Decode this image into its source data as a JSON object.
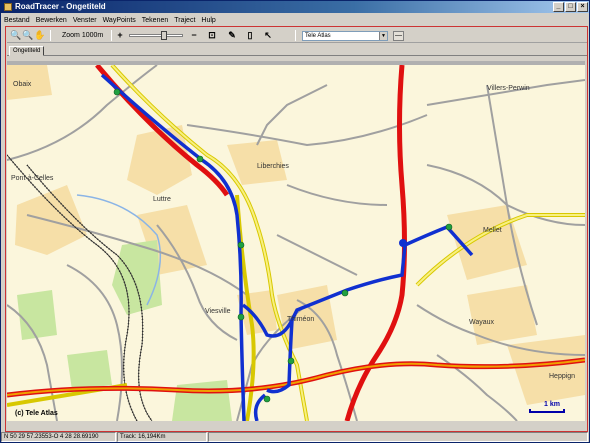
{
  "window": {
    "title": "RoadTracer - Ongetiteld",
    "controls": [
      "_",
      "□",
      "×"
    ]
  },
  "menu": [
    "Bestand",
    "Bewerken",
    "Venster",
    "WayPoints",
    "Tekenen",
    "Traject",
    "Hulp"
  ],
  "toolbar": {
    "zoom_label": "Zoom 1000m",
    "map_source": "Tele Atlas",
    "buttons": {
      "zoom_in_glass": "🔍",
      "zoom_out_glass": "🔍",
      "hand": "✋",
      "plus": "+",
      "minus": "−",
      "fit": "⊡",
      "draw": "✎",
      "panel": "▯",
      "cursor": "↖",
      "collapse": "—"
    }
  },
  "tabs": [
    "Ongetiteld"
  ],
  "map": {
    "copyright": "(c) Tele Atlas",
    "scale_label": "1 km",
    "places": [
      "Obaix",
      "Villers-Perwin",
      "Liberchies",
      "Pont-à-Celles",
      "Luttre",
      "Mellet",
      "Viesville",
      "Thiméon",
      "Wayaux",
      "Heppign"
    ]
  },
  "status": {
    "coords": "N 50 29 57.23553-O 4 28 28.69190",
    "track": "Track: 16,194Km"
  }
}
